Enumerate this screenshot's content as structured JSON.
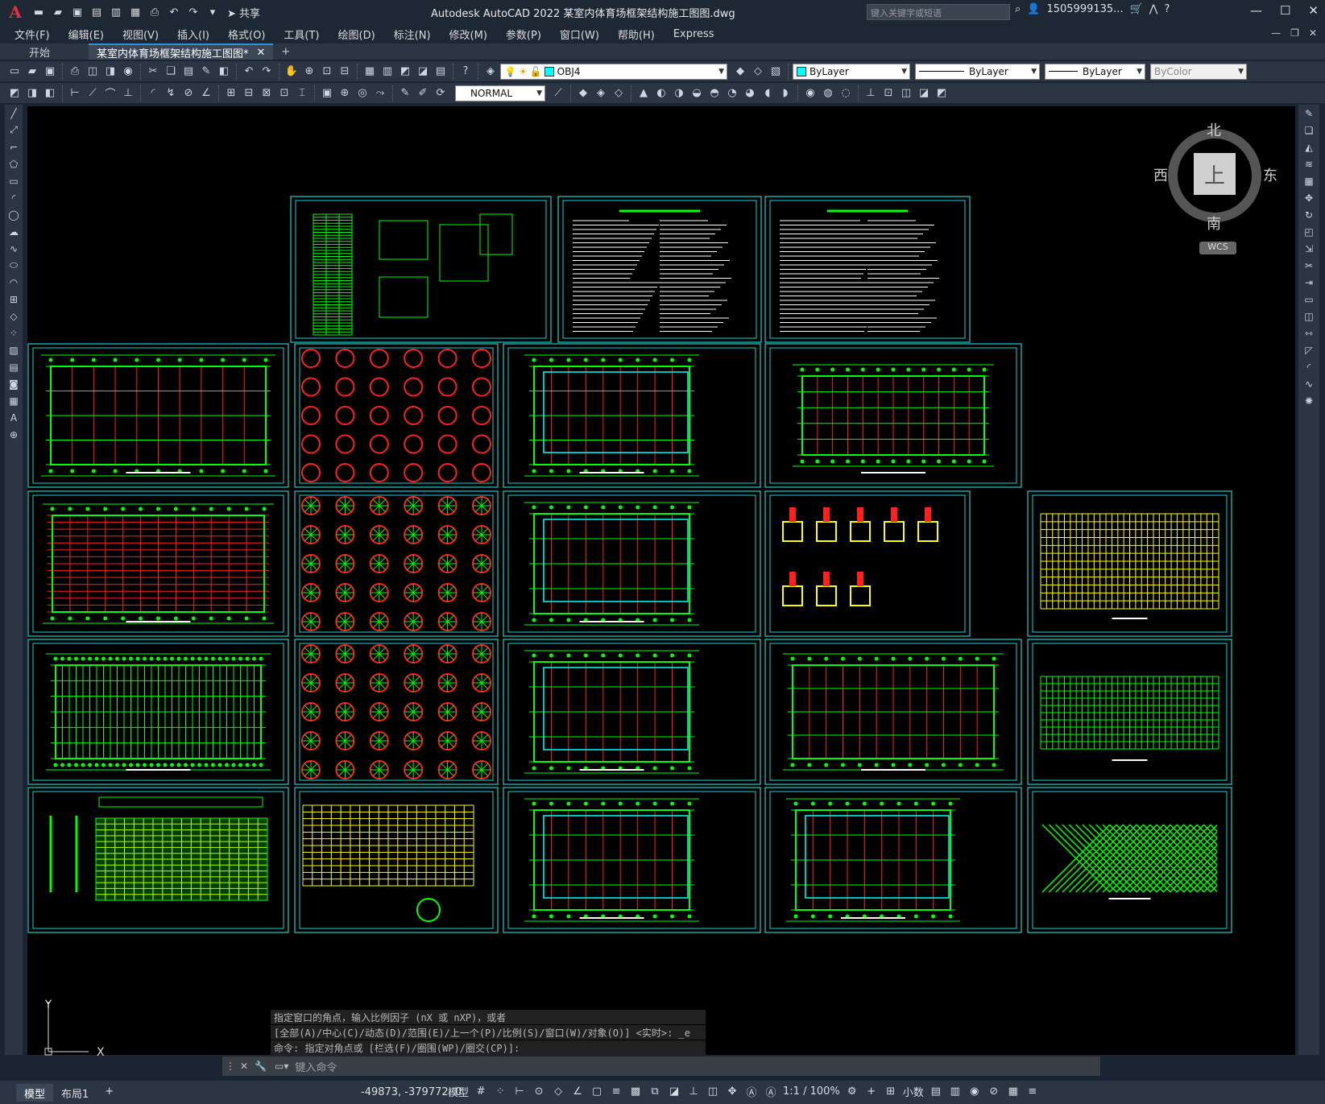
{
  "app": {
    "logo": "A",
    "title": "Autodesk AutoCAD 2022    某室内体育场框架结构施工图图.dwg",
    "share_label": "共享",
    "search_placeholder": "键入关键字或短语",
    "user": "1505999135...",
    "help": "?"
  },
  "menu": [
    "文件(F)",
    "编辑(E)",
    "视图(V)",
    "插入(I)",
    "格式(O)",
    "工具(T)",
    "绘图(D)",
    "标注(N)",
    "修改(M)",
    "参数(P)",
    "窗口(W)",
    "帮助(H)",
    "Express"
  ],
  "tabs": {
    "start": "开始",
    "active": "某室内体育场框架结构施工图图*",
    "plus": "+"
  },
  "toolbar": {
    "layer": "OBJ4",
    "color": "ByLayer",
    "linetype": "ByLayer",
    "lineweight": "ByLayer",
    "plotstyle": "ByColor",
    "dimstyle": "NORMAL",
    "layer_color": "#00ffff",
    "color_swatch": "#00ffff"
  },
  "viewcube": {
    "north": "北",
    "south": "南",
    "east": "东",
    "west": "西",
    "face": "上",
    "wcs": "WCS"
  },
  "ucs": {
    "x": "X",
    "y": "Y"
  },
  "command": {
    "history": [
      "指定窗口的角点，输入比例因子 (nX 或 nXP)，或者",
      "[全部(A)/中心(C)/动态(D)/范围(E)/上一个(P)/比例(S)/窗口(W)/对象(O)] <实时>: _e",
      "命令: 指定对角点或 [栏选(F)/圈围(WP)/圈交(CP)]:"
    ],
    "placeholder": "键入命令"
  },
  "status": {
    "model_tab": "模型",
    "layout_tab": "布局1",
    "plus": "+",
    "coords": "-49873, -379772, 0",
    "model_label": "模型",
    "scale": "1:1 / 100%",
    "units": "小数"
  },
  "colors": {
    "sheet_border": "#1ecfcf",
    "green": "#00ff00",
    "red": "#ff2020",
    "yellow": "#ffff00",
    "cyan": "#00ffff"
  }
}
